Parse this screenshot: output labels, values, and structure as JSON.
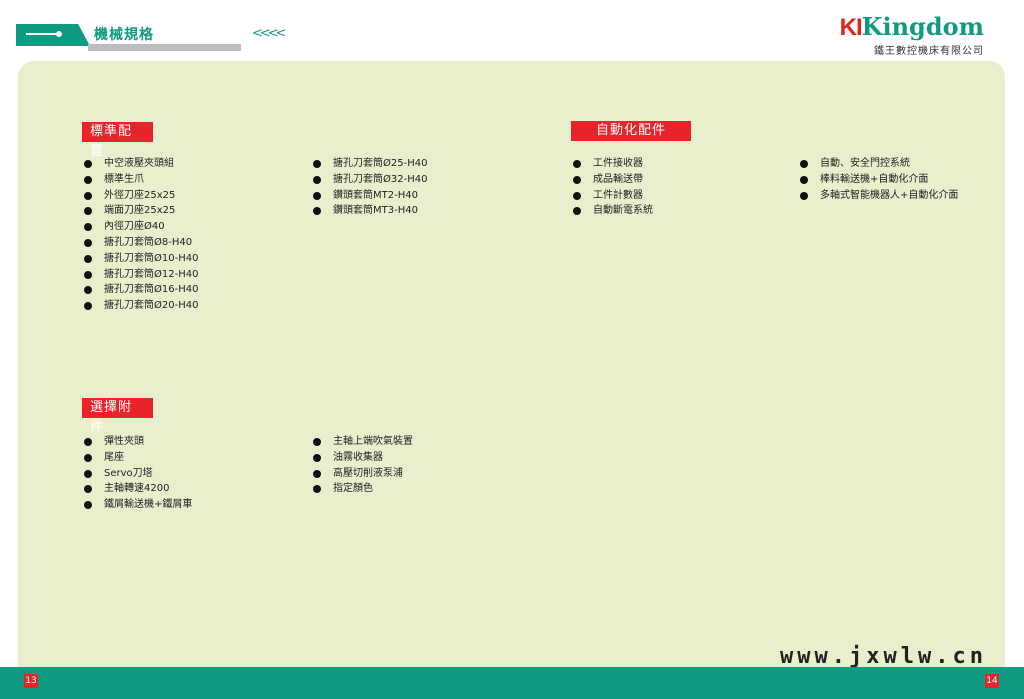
{
  "header": {
    "title": "機械規格",
    "chevrons": "<<<<",
    "logo_ki": "KI",
    "logo_kingdom": "Kingdom",
    "company": "鐵王數控機床有限公司"
  },
  "sections": {
    "standard": {
      "title": "標準配置",
      "col1": [
        "中空液壓夾頭組",
        "標準生爪",
        "外徑刀座25x25",
        "端面刀座25x25",
        "內徑刀座Ø40",
        "搪孔刀套筒Ø8-H40",
        "搪孔刀套筒Ø10-H40",
        "搪孔刀套筒Ø12-H40",
        "搪孔刀套筒Ø16-H40",
        "搪孔刀套筒Ø20-H40"
      ],
      "col2": [
        "搪孔刀套筒Ø25-H40",
        "搪孔刀套筒Ø32-H40",
        "鑽頭套筒MT2-H40",
        "鑽頭套筒MT3-H40"
      ]
    },
    "automation": {
      "title": "自動化配件",
      "col1": [
        "工件接收器",
        "成品輸送帶",
        "工件計數器",
        "自動斷電系統"
      ],
      "col2": [
        "自動、安全門控系統",
        "棒料輸送機+自動化介面",
        "多軸式智能機器人+自動化介面"
      ]
    },
    "optional": {
      "title": "選擇附件",
      "col1": [
        "彈性夾頭",
        "尾座",
        "Servo刀塔",
        "主軸轉速4200",
        "鐵屑輸送機+鐵屑車"
      ],
      "col2": [
        "主軸上端吹氣裝置",
        "油霧收集器",
        "高壓切削液泵浦",
        "指定顏色"
      ]
    }
  },
  "footer": {
    "page_left": "13",
    "page_right": "14",
    "watermark": "www.jxwlw.cn"
  },
  "colors": {
    "accent_green": "#0f9b82",
    "tag_red": "#e8232a",
    "panel_bg": "#e7efcd"
  }
}
